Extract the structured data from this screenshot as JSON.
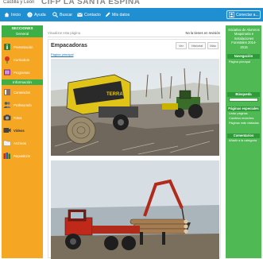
{
  "header": {
    "subtitle": "Castilla y León",
    "title": "CIFP LA SANTA ESPINA"
  },
  "nav": {
    "items": [
      {
        "label": "Inicio",
        "icon": "home-icon"
      },
      {
        "label": "Ayuda",
        "icon": "help-icon"
      },
      {
        "label": "Buscar",
        "icon": "search-icon"
      },
      {
        "label": "Contacto",
        "icon": "mail-icon"
      },
      {
        "label": "Mis datos",
        "icon": "pencil-icon"
      }
    ],
    "user_label": "Conectar a..."
  },
  "sidebar": {
    "section1_title": "SECCIONES",
    "section1_sub": "General",
    "section2_title": "Información",
    "items": [
      {
        "label": "Presentación",
        "icon": "info-icon"
      },
      {
        "label": "Curriculum",
        "icon": "flower-icon"
      },
      {
        "label": "Programas",
        "icon": "book-icon"
      },
      {
        "label": "Contenidos",
        "icon": "book-icon"
      },
      {
        "label": "Profesorado",
        "icon": "people-icon"
      },
      {
        "label": "Fotos",
        "icon": "camera-icon"
      },
      {
        "label": "Vídeos",
        "icon": "video-icon"
      },
      {
        "label": "Archivos",
        "icon": "folder-icon"
      },
      {
        "label": "Repositorio",
        "icon": "books-icon"
      }
    ]
  },
  "content": {
    "breadcrumb": "Visualizar esta página",
    "breadcrumb_right": "No la tienes en revisión",
    "page_title": "Empacadoras",
    "buttons": [
      "Ver",
      "Historial",
      "Más"
    ],
    "link": "Página principal"
  },
  "rightcol": {
    "intro": "Iniciativa de Alumnos Maquinaria e Instalaciones Forestales 2014-2015",
    "nav_header": "Navegación",
    "nav_link": "Página principal",
    "search_header": "Búsqueda",
    "pages_header": "Páginas especiales",
    "pages_links": [
      "Listar páginas",
      "Cambios recientes",
      "Páginas más visitadas"
    ],
    "comments_header": "Comentarios",
    "comments_link": "Añadir a la categoría"
  },
  "colors": {
    "nav_blue": "#1f8fd2",
    "sidebar_orange": "#f5a623",
    "green": "#3cb046"
  }
}
